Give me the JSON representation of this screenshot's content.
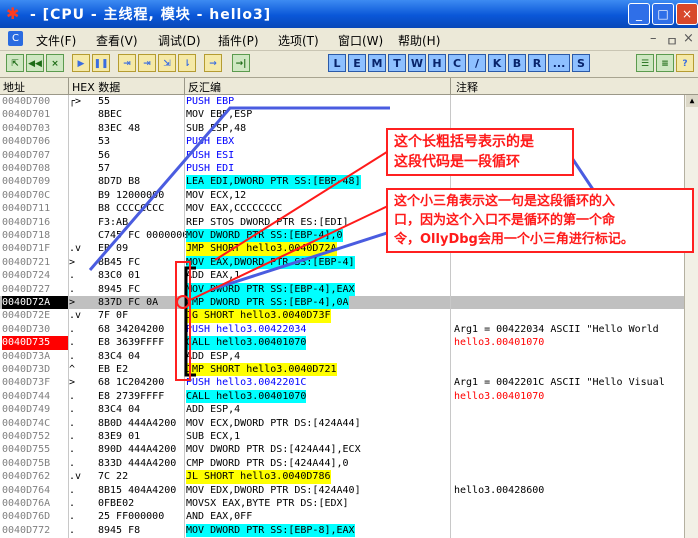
{
  "window": {
    "title": "- [CPU - 主线程, 模块 - hello3]",
    "buttons": {
      "minimize": "_",
      "maximize": "□",
      "close": "×"
    }
  },
  "menu": {
    "items": [
      "文件(F)",
      "查看(V)",
      "调试(D)",
      "插件(P)",
      "选项(T)",
      "窗口(W)",
      "帮助(H)"
    ],
    "right_controls": [
      "–",
      "ㅁ",
      "×"
    ]
  },
  "toolbar": {
    "left_buttons": [
      "⇱",
      "◀◀",
      "×",
      "▶",
      "❚❚",
      "⇥",
      "⇥",
      "⇲",
      "⇂",
      "→",
      "→|"
    ],
    "letter_buttons": [
      "L",
      "E",
      "M",
      "T",
      "W",
      "H",
      "C",
      "/",
      "K",
      "B",
      "R",
      "...",
      "S"
    ],
    "right_buttons": [
      "☰",
      "≡",
      "?"
    ]
  },
  "columns": {
    "address": "地址",
    "hex": "HEX 数据",
    "disasm": "反汇编",
    "comment": "注释"
  },
  "rows": [
    {
      "addr": "0040D700",
      "mk": "┌>",
      "hex": "55",
      "dis": "PUSH EBP",
      "style": "push"
    },
    {
      "addr": "0040D701",
      "mk": "",
      "hex": "8BEC",
      "dis": "MOV EBP,ESP"
    },
    {
      "addr": "0040D703",
      "mk": "",
      "hex": "83EC 48",
      "dis": "SUB ESP,48"
    },
    {
      "addr": "0040D706",
      "mk": "",
      "hex": "53",
      "dis": "PUSH EBX",
      "style": "push"
    },
    {
      "addr": "0040D707",
      "mk": "",
      "hex": "56",
      "dis": "PUSH ESI",
      "style": "push"
    },
    {
      "addr": "0040D708",
      "mk": "",
      "hex": "57",
      "dis": "PUSH EDI",
      "style": "push"
    },
    {
      "addr": "0040D709",
      "mk": "",
      "hex": "8D7D B8",
      "dis": "LEA EDI,DWORD PTR SS:[EBP-48]",
      "style": "mem"
    },
    {
      "addr": "0040D70C",
      "mk": "",
      "hex": "B9 12000000",
      "dis": "MOV ECX,12"
    },
    {
      "addr": "0040D711",
      "mk": "",
      "hex": "B8 CCCCCCCC",
      "dis": "MOV EAX,CCCCCCCC"
    },
    {
      "addr": "0040D716",
      "mk": "",
      "hex": "F3:AB",
      "dis": "REP STOS DWORD PTR ES:[EDI]"
    },
    {
      "addr": "0040D718",
      "mk": "",
      "hex": "C745 FC 00000000",
      "dis": "MOV DWORD PTR SS:[EBP-4],0",
      "style": "mem"
    },
    {
      "addr": "0040D71F",
      "mk": ".v",
      "hex": "EB 09",
      "dis": "JMP SHORT hello3.0040D72A",
      "style": "jmp"
    },
    {
      "addr": "0040D721",
      "mk": ">",
      "hex": "8B45 FC",
      "dis": "MOV EAX,DWORD PTR SS:[EBP-4]",
      "style": "mem"
    },
    {
      "addr": "0040D724",
      "mk": ".",
      "hex": "83C0 01",
      "dis": "ADD EAX,1"
    },
    {
      "addr": "0040D727",
      "mk": ".",
      "hex": "8945 FC",
      "dis": "MOV DWORD PTR SS:[EBP-4],EAX",
      "style": "mem"
    },
    {
      "addr": "0040D72A",
      "mk": ">",
      "hex": "837D FC 0A",
      "dis": "CMP DWORD PTR SS:[EBP-4],0A",
      "style": "mem",
      "row": "sel"
    },
    {
      "addr": "0040D72E",
      "mk": ".v",
      "hex": "7F 0F",
      "dis": "JG SHORT hello3.0040D73F",
      "style": "jmp"
    },
    {
      "addr": "0040D730",
      "mk": ".",
      "hex": "68 34204200",
      "dis": "PUSH hello3.00422034",
      "style": "push"
    },
    {
      "addr": "0040D735",
      "mk": ".",
      "hex": "E8 3639FFFF",
      "dis": "CALL hello3.00401070",
      "style": "call",
      "row": "bp"
    },
    {
      "addr": "0040D73A",
      "mk": ".",
      "hex": "83C4 04",
      "dis": "ADD ESP,4"
    },
    {
      "addr": "0040D73D",
      "mk": "^",
      "hex": "EB E2",
      "dis": "JMP SHORT hello3.0040D721",
      "style": "jmp"
    },
    {
      "addr": "0040D73F",
      "mk": ">",
      "hex": "68 1C204200",
      "dis": "PUSH hello3.0042201C",
      "style": "push"
    },
    {
      "addr": "0040D744",
      "mk": ".",
      "hex": "E8 2739FFFF",
      "dis": "CALL hello3.00401070",
      "style": "call"
    },
    {
      "addr": "0040D749",
      "mk": ".",
      "hex": "83C4 04",
      "dis": "ADD ESP,4"
    },
    {
      "addr": "0040D74C",
      "mk": ".",
      "hex": "8B0D 444A4200",
      "dis": "MOV ECX,DWORD PTR DS:[424A44]"
    },
    {
      "addr": "0040D752",
      "mk": ".",
      "hex": "83E9 01",
      "dis": "SUB ECX,1"
    },
    {
      "addr": "0040D755",
      "mk": ".",
      "hex": "890D 444A4200",
      "dis": "MOV DWORD PTR DS:[424A44],ECX"
    },
    {
      "addr": "0040D75B",
      "mk": ".",
      "hex": "833D 444A4200",
      "dis": "CMP DWORD PTR DS:[424A44],0"
    },
    {
      "addr": "0040D762",
      "mk": ".v",
      "hex": "7C 22",
      "dis": "JL SHORT hello3.0040D786",
      "style": "jmp"
    },
    {
      "addr": "0040D764",
      "mk": ".",
      "hex": "8B15 404A4200",
      "dis": "MOV EDX,DWORD PTR DS:[424A40]"
    },
    {
      "addr": "0040D76A",
      "mk": ".",
      "hex": "0FBE02",
      "dis": "MOVSX EAX,BYTE PTR DS:[EDX]"
    },
    {
      "addr": "0040D76D",
      "mk": ".",
      "hex": "25 FF000000",
      "dis": "AND EAX,0FF"
    },
    {
      "addr": "0040D772",
      "mk": ".",
      "hex": "8945 F8",
      "dis": "MOV DWORD PTR SS:[EBP-8],EAX",
      "style": "mem"
    }
  ],
  "comments": [
    {
      "row": 17,
      "text": "Arg1 = 00422034 ASCII \"Hello World",
      "red": false
    },
    {
      "row": 18,
      "text": "hello3.00401070",
      "red": true
    },
    {
      "row": 21,
      "text": "Arg1 = 0042201C ASCII \"Hello Visual",
      "red": false
    },
    {
      "row": 22,
      "text": "hello3.00401070",
      "red": true
    },
    {
      "row": 29,
      "text": "hello3.00428600",
      "red": false
    }
  ],
  "annotations": {
    "top": "这个长粗括号表示的是这段代码是一段循环",
    "top_line1": "这个长粗括号表示的是",
    "top_line2": "这段代码是一段循环",
    "bottom_line1": "这个小三角表示这一句是这段循环的入",
    "bottom_line2": "口，因为这个入口不是循环的第一个命",
    "bottom_line3": "令，OllyDbg会用一个小三角进行标记。"
  },
  "colors": {
    "title_bar": "#0a57d8",
    "annotation_red": "#ff1a1a",
    "call_highlight": "#00ffff",
    "jump_highlight": "#ffff00",
    "push_text": "#0000ff",
    "breakpoint": "#ff0000",
    "arrow_blue": "#4a5ce0"
  }
}
